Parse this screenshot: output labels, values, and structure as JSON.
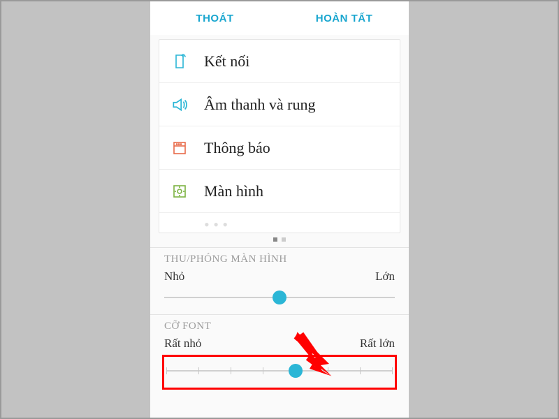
{
  "header": {
    "cancel": "THOÁT",
    "done": "HOÀN TẤT"
  },
  "settings_list": [
    {
      "icon": "connection",
      "label": "Kết nối"
    },
    {
      "icon": "sound",
      "label": "Âm thanh và rung"
    },
    {
      "icon": "notification",
      "label": "Thông báo"
    },
    {
      "icon": "display",
      "label": "Màn hình"
    }
  ],
  "sections": {
    "zoom": {
      "title": "THU/PHÓNG MÀN HÌNH",
      "min_label": "Nhỏ",
      "max_label": "Lớn",
      "value_percent": 50
    },
    "font": {
      "title": "CỠ FONT",
      "min_label": "Rất nhỏ",
      "max_label": "Rất lớn",
      "value_percent": 57
    }
  },
  "colors": {
    "accent": "#2bb6d6",
    "highlight": "#ff0000"
  }
}
